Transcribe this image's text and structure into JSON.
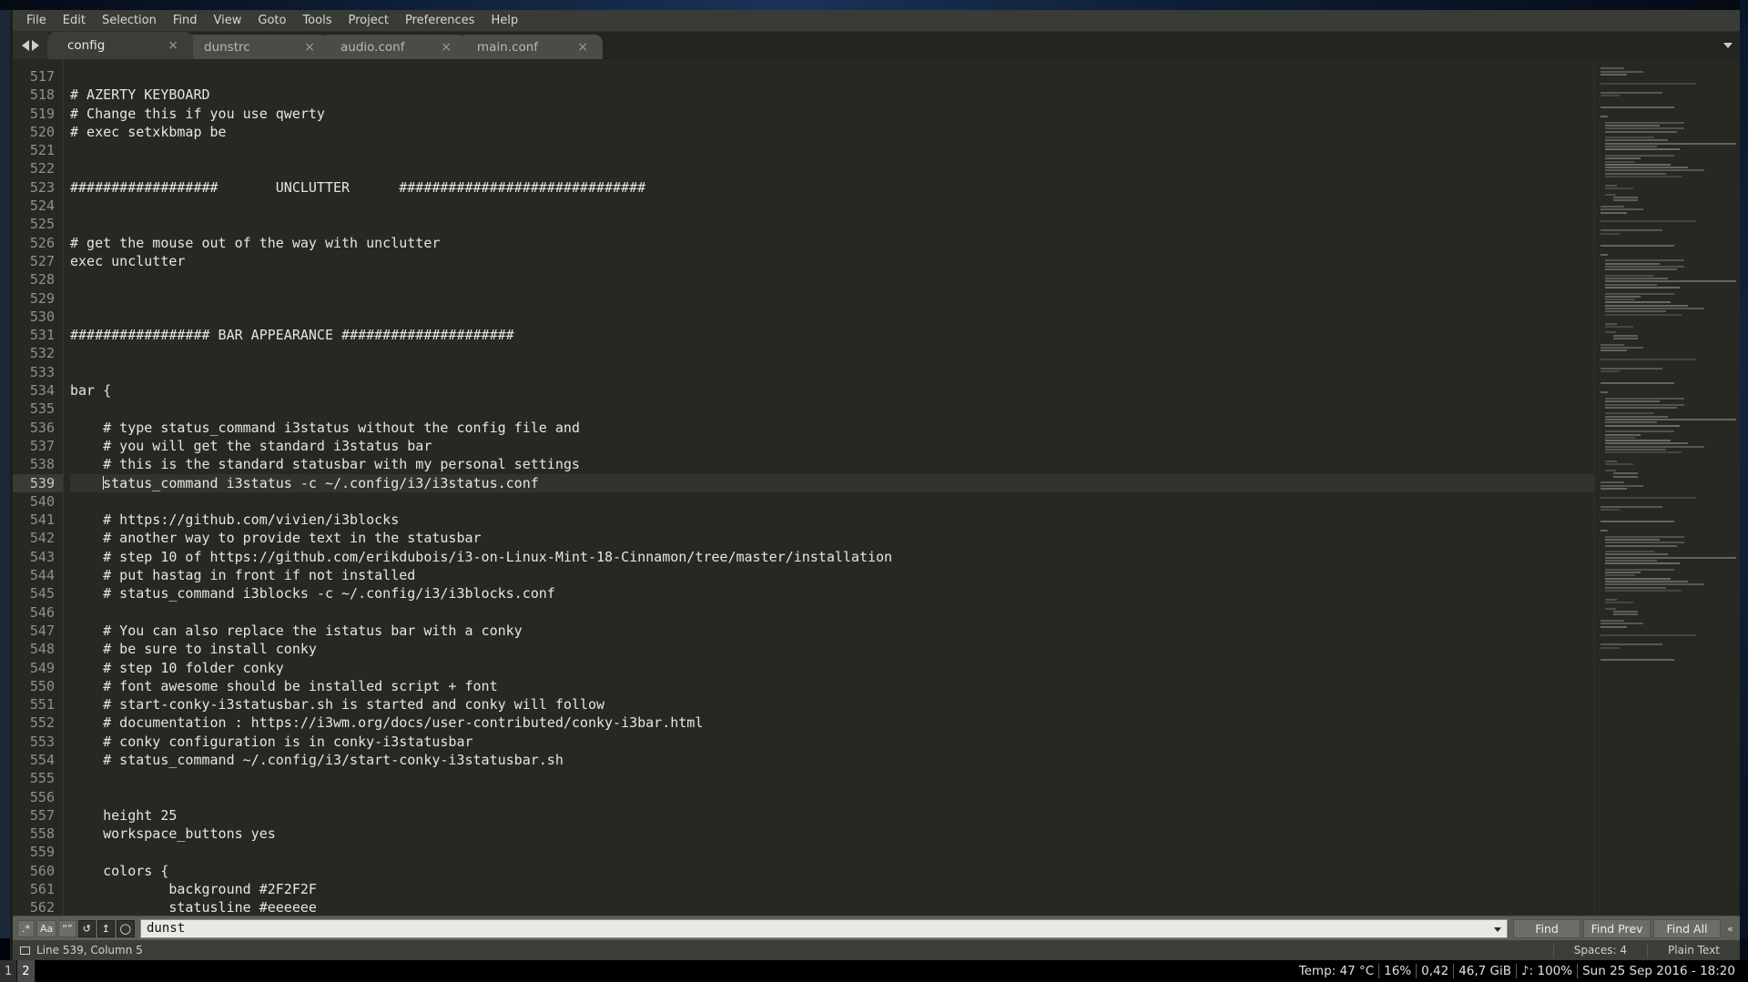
{
  "menubar": {
    "items": [
      {
        "label": "File"
      },
      {
        "label": "Edit"
      },
      {
        "label": "Selection"
      },
      {
        "label": "Find"
      },
      {
        "label": "View"
      },
      {
        "label": "Goto"
      },
      {
        "label": "Tools"
      },
      {
        "label": "Project"
      },
      {
        "label": "Preferences"
      },
      {
        "label": "Help"
      }
    ]
  },
  "tabbar": {
    "close_glyph": "×",
    "tabs": [
      {
        "label": "config",
        "active": true
      },
      {
        "label": "dunstrc",
        "active": false
      },
      {
        "label": "audio.conf",
        "active": false
      },
      {
        "label": "main.conf",
        "active": false
      }
    ]
  },
  "editor": {
    "first_line": 517,
    "active_line": 539,
    "lines": [
      {
        "n": 517,
        "text": ""
      },
      {
        "n": 518,
        "text": "# AZERTY KEYBOARD"
      },
      {
        "n": 519,
        "text": "# Change this if you use qwerty"
      },
      {
        "n": 520,
        "text": "# exec setxkbmap be"
      },
      {
        "n": 521,
        "text": ""
      },
      {
        "n": 522,
        "text": ""
      },
      {
        "n": 523,
        "text": "##################       UNCLUTTER      ##############################"
      },
      {
        "n": 524,
        "text": ""
      },
      {
        "n": 525,
        "text": ""
      },
      {
        "n": 526,
        "text": "# get the mouse out of the way with unclutter"
      },
      {
        "n": 527,
        "text": "exec unclutter"
      },
      {
        "n": 528,
        "text": ""
      },
      {
        "n": 529,
        "text": ""
      },
      {
        "n": 530,
        "text": ""
      },
      {
        "n": 531,
        "text": "################# BAR APPEARANCE #####################"
      },
      {
        "n": 532,
        "text": ""
      },
      {
        "n": 533,
        "text": ""
      },
      {
        "n": 534,
        "text": "bar {"
      },
      {
        "n": 535,
        "text": ""
      },
      {
        "n": 536,
        "text": "    # type status_command i3status without the config file and"
      },
      {
        "n": 537,
        "text": "    # you will get the standard i3status bar"
      },
      {
        "n": 538,
        "text": "    # this is the standard statusbar with my personal settings"
      },
      {
        "n": 539,
        "text": "    status_command i3status -c ~/.config/i3/i3status.conf"
      },
      {
        "n": 540,
        "text": ""
      },
      {
        "n": 541,
        "text": "    # https://github.com/vivien/i3blocks"
      },
      {
        "n": 542,
        "text": "    # another way to provide text in the statusbar"
      },
      {
        "n": 543,
        "text": "    # step 10 of https://github.com/erikdubois/i3-on-Linux-Mint-18-Cinnamon/tree/master/installation"
      },
      {
        "n": 544,
        "text": "    # put hastag in front if not installed"
      },
      {
        "n": 545,
        "text": "    # status_command i3blocks -c ~/.config/i3/i3blocks.conf"
      },
      {
        "n": 546,
        "text": ""
      },
      {
        "n": 547,
        "text": "    # You can also replace the istatus bar with a conky"
      },
      {
        "n": 548,
        "text": "    # be sure to install conky"
      },
      {
        "n": 549,
        "text": "    # step 10 folder conky"
      },
      {
        "n": 550,
        "text": "    # font awesome should be installed script + font"
      },
      {
        "n": 551,
        "text": "    # start-conky-i3statusbar.sh is started and conky will follow"
      },
      {
        "n": 552,
        "text": "    # documentation : https://i3wm.org/docs/user-contributed/conky-i3bar.html"
      },
      {
        "n": 553,
        "text": "    # conky configuration is in conky-i3statusbar"
      },
      {
        "n": 554,
        "text": "    # status_command ~/.config/i3/start-conky-i3statusbar.sh"
      },
      {
        "n": 555,
        "text": ""
      },
      {
        "n": 556,
        "text": ""
      },
      {
        "n": 557,
        "text": "    height 25"
      },
      {
        "n": 558,
        "text": "    workspace_buttons yes"
      },
      {
        "n": 559,
        "text": ""
      },
      {
        "n": 560,
        "text": "    colors {"
      },
      {
        "n": 561,
        "text": "            background #2F2F2F"
      },
      {
        "n": 562,
        "text": "            statusline #eeeeee"
      }
    ]
  },
  "findbar": {
    "toggles": [
      {
        "name": "regex-toggle",
        "glyph": ".*",
        "on": false
      },
      {
        "name": "case-sensitive-toggle",
        "glyph": "Aa",
        "on": false
      },
      {
        "name": "whole-word-toggle",
        "glyph": "“”",
        "on": false
      },
      {
        "name": "wrap-toggle",
        "glyph": "↺",
        "on": true
      },
      {
        "name": "in-selection-toggle",
        "glyph": "↥",
        "on": true
      },
      {
        "name": "highlight-matches-toggle",
        "glyph": "◯",
        "on": true
      }
    ],
    "query": "dunst",
    "placeholder": "Find",
    "buttons": [
      {
        "name": "find-button",
        "label": "Find"
      },
      {
        "name": "find-prev-button",
        "label": "Find Prev"
      },
      {
        "name": "find-all-button",
        "label": "Find All"
      }
    ],
    "more_glyph": "«"
  },
  "statusbar": {
    "position": "Line 539, Column 5",
    "indentation": "Spaces: 4",
    "syntax": "Plain Text"
  },
  "i3bar": {
    "workspaces": [
      {
        "label": "1",
        "focused": false
      },
      {
        "label": "2",
        "focused": true
      }
    ],
    "status": [
      {
        "name": "temperature",
        "text": "Temp: 47 °C"
      },
      {
        "name": "cpu-load",
        "text": "16%"
      },
      {
        "name": "load-avg",
        "text": "0,42"
      },
      {
        "name": "disk-free",
        "text": "46,7 GiB"
      },
      {
        "name": "volume",
        "text": "♪: 100%"
      },
      {
        "name": "datetime",
        "text": "Sun 25 Sep 2016 - 18:20"
      }
    ]
  }
}
